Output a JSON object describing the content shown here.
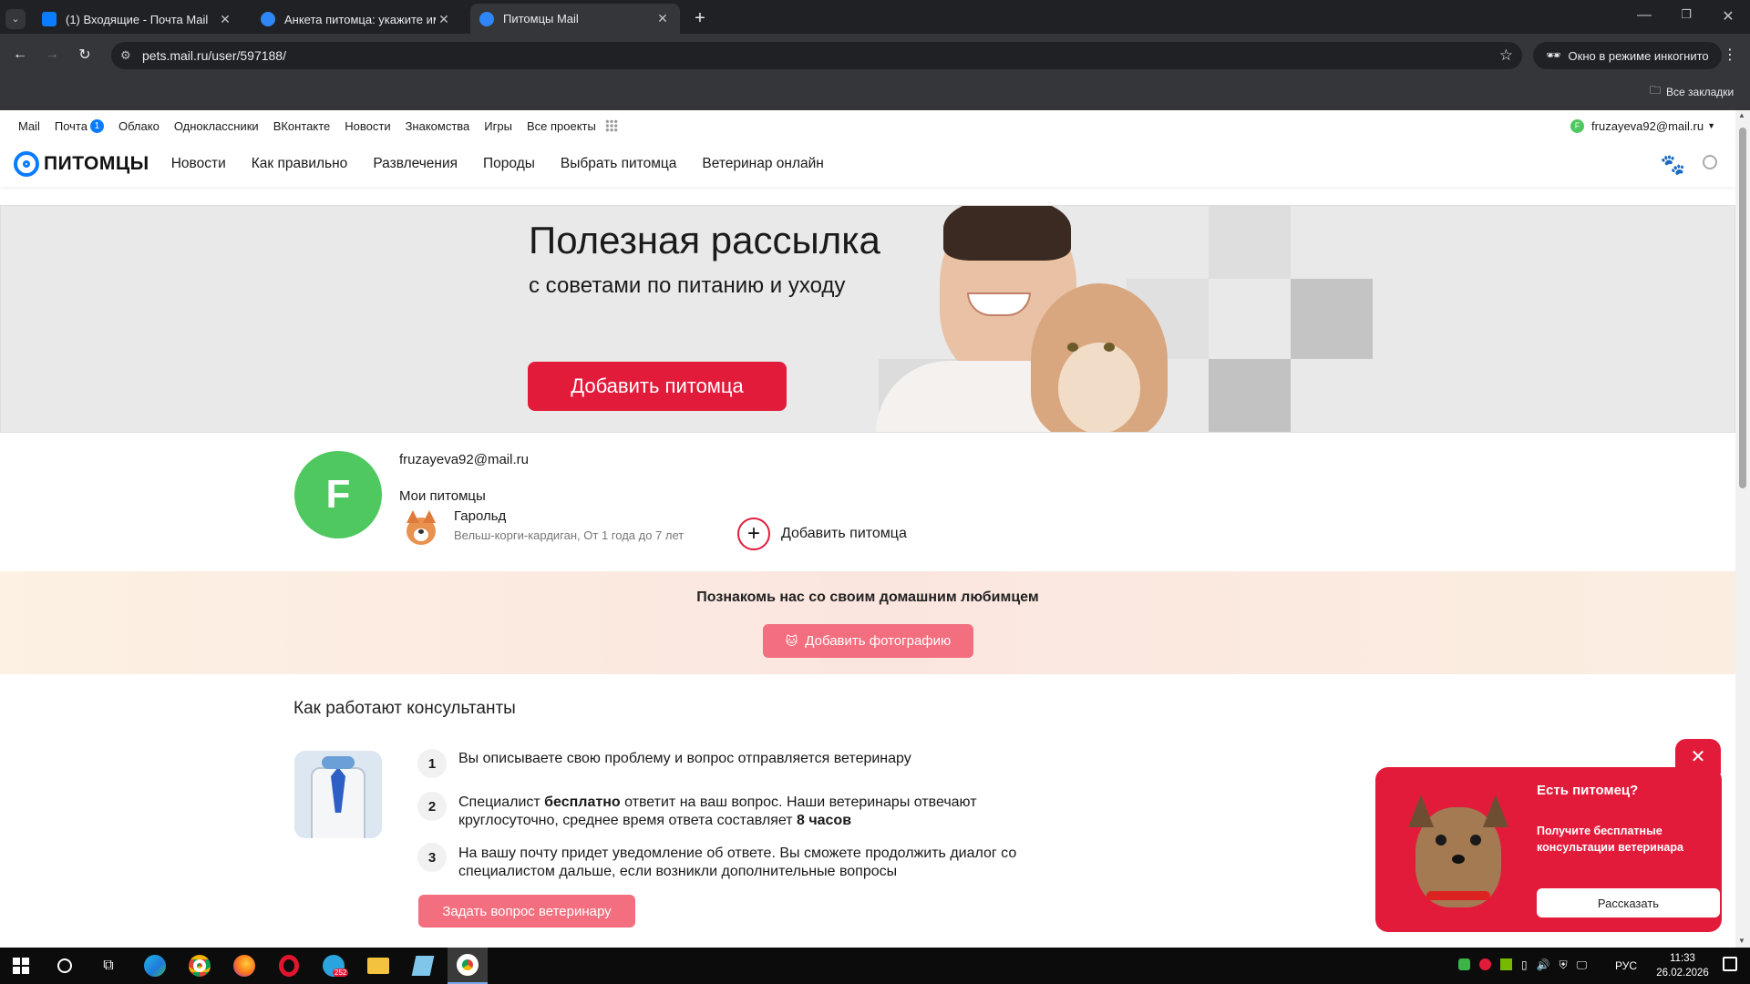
{
  "browser": {
    "tabs": [
      {
        "title": "(1) Входящие - Почта Mail",
        "active": false
      },
      {
        "title": "Анкета питомца: укажите имя",
        "active": false
      },
      {
        "title": "Питомцы Mail",
        "active": true
      }
    ],
    "url": "pets.mail.ru/user/597188/",
    "incognito_label": "Окно в режиме инкогнито",
    "bookmarks_label": "Все закладки"
  },
  "portal_bar": {
    "items": [
      "Mail",
      "Почта",
      "Облако",
      "Одноклассники",
      "ВКонтакте",
      "Новости",
      "Знакомства",
      "Игры",
      "Все проекты"
    ],
    "mail_badge": "1",
    "user_email": "fruzayeva92@mail.ru",
    "user_initial": "F"
  },
  "site_nav": {
    "logo_text": "ПИТОМЦЫ",
    "links": [
      "Новости",
      "Как правильно",
      "Развлечения",
      "Породы",
      "Выбрать питомца",
      "Ветеринар онлайн"
    ]
  },
  "banner": {
    "title": "Полезная рассылка",
    "subtitle": "с советами по питанию и уходу",
    "button": "Добавить питомца"
  },
  "profile": {
    "avatar_letter": "F",
    "email": "fruzayeva92@mail.ru",
    "my_pets_label": "Мои питомцы",
    "pet_name": "Гарольд",
    "pet_desc": "Вельш-корги-кардиган, От 1 года до 7 лет",
    "add_pet": "Добавить питомца"
  },
  "promo": {
    "heading": "Познакомь нас со своим домашним любимцем",
    "button": "Добавить фотографию"
  },
  "consult": {
    "heading": "Как работают консультанты",
    "steps": [
      {
        "num": "1",
        "line1": "Вы описываете свою проблему и вопрос отправляется ветеринару",
        "line2": ""
      },
      {
        "num": "2",
        "line1_a": "Специалист ",
        "line1_b": "бесплатно",
        "line1_c": " ответит на ваш вопрос. Наши ветеринары отвечают",
        "line2_a": "круглосуточно, среднее время ответа составляет ",
        "line2_b": "8 часов"
      },
      {
        "num": "3",
        "line1": "На вашу почту придет уведомление об ответе. Вы сможете продолжить диалог со",
        "line2": "специалистом дальше, если возникли дополнительные вопросы"
      }
    ],
    "button": "Задать вопрос ветеринару"
  },
  "popup": {
    "title": "Есть питомец?",
    "text": "Получите бесплатные консультации ветеринара",
    "button": "Рассказать"
  },
  "taskbar": {
    "lang": "РУС",
    "time": "11:33",
    "date": "26.02.2026",
    "telegram_badge": "252"
  },
  "colors": {
    "brand_red": "#e31b3b",
    "soft_red": "#f36f7f",
    "avatar_green": "#4ec85f",
    "logo_blue": "#0a7cff"
  }
}
